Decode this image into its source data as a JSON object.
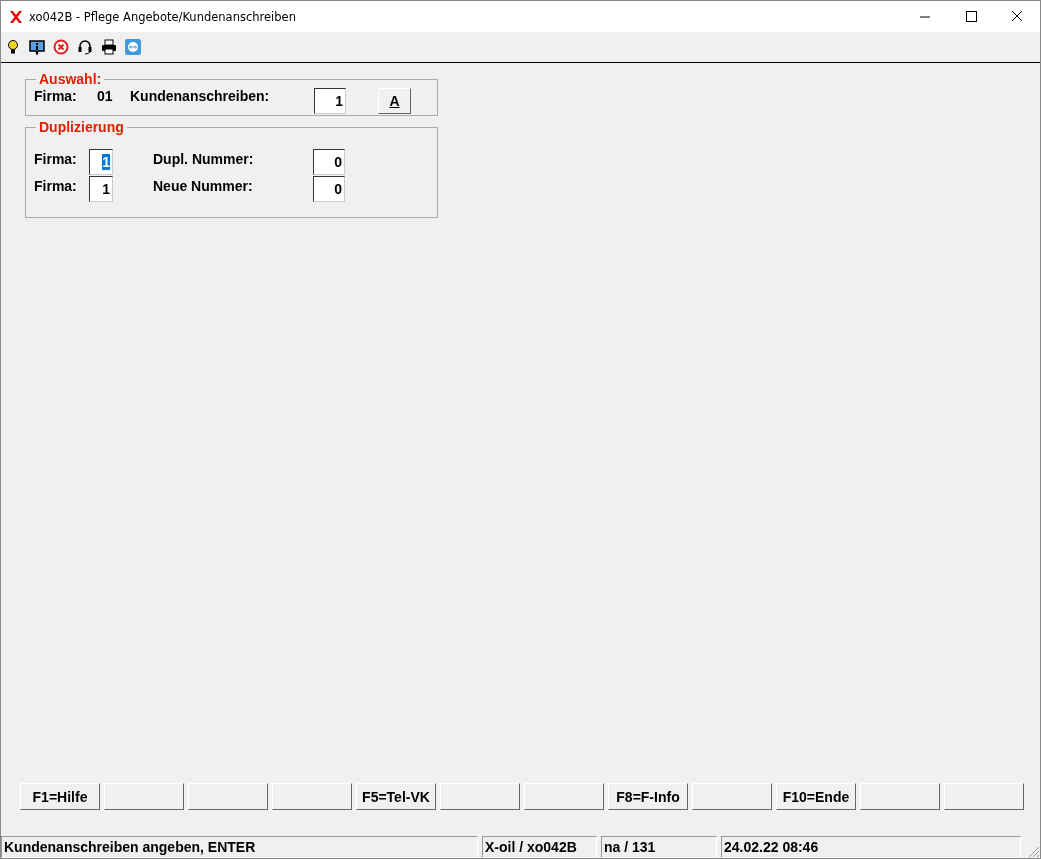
{
  "window": {
    "title": "xo042B - Pflege Angebote/Kundenanschreiben"
  },
  "toolbar": [
    {
      "kind": "bulb"
    },
    {
      "kind": "info"
    },
    {
      "kind": "cancel"
    },
    {
      "kind": "headset"
    },
    {
      "kind": "printer"
    },
    {
      "kind": "remote"
    }
  ],
  "auswahl": {
    "title": "Auswahl:",
    "firma_label": "Firma:",
    "firma_value": "01",
    "field_label": "Kundenanschreiben:",
    "field_value": "1",
    "button": "A"
  },
  "duplizierung": {
    "title": "Duplizierung",
    "rows": [
      {
        "left_label": "Firma:",
        "left_value": "1",
        "left_selected": true,
        "right_label": "Dupl. Nummer:",
        "right_value": "0"
      },
      {
        "left_label": "Firma:",
        "left_value": "1",
        "left_selected": false,
        "right_label": "Neue Nummer:",
        "right_value": "0"
      }
    ]
  },
  "function_keys": [
    {
      "kind": "labeled",
      "label": "F1=Hilfe"
    },
    {
      "kind": "empty"
    },
    {
      "kind": "empty"
    },
    {
      "kind": "empty"
    },
    {
      "kind": "labeled",
      "label": "F5=Tel-VK"
    },
    {
      "kind": "empty"
    },
    {
      "kind": "empty"
    },
    {
      "kind": "labeled",
      "label": "F8=F-Info"
    },
    {
      "kind": "empty"
    },
    {
      "kind": "labeled",
      "label": "F10=Ende"
    },
    {
      "kind": "empty"
    },
    {
      "kind": "empty"
    }
  ],
  "status_bar": [
    "Kundenanschreiben angeben, ENTER",
    "X-oil / xo042B",
    "na / 131",
    "24.02.22 08:46"
  ]
}
